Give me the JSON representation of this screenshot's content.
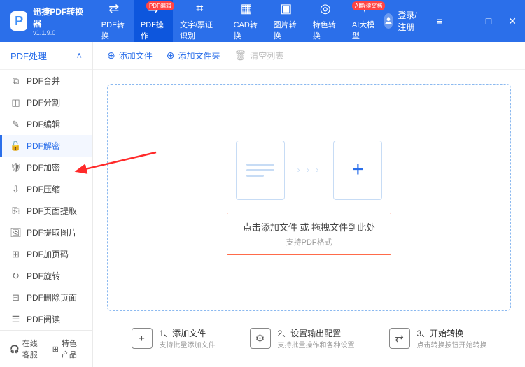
{
  "app": {
    "title": "迅捷PDF转换器",
    "version": "v1.1.9.0"
  },
  "nav": [
    {
      "label": "PDF转换",
      "icon": "⇄"
    },
    {
      "label": "PDF操作",
      "icon": "⇆",
      "badge": "PDF编辑",
      "active": true
    },
    {
      "label": "文字/票证识别",
      "icon": "⌗"
    },
    {
      "label": "CAD转换",
      "icon": "▦"
    },
    {
      "label": "图片转换",
      "icon": "▣"
    },
    {
      "label": "特色转换",
      "icon": "◎"
    },
    {
      "label": "AI大模型",
      "icon": "✦",
      "badge": "AI解读文档"
    }
  ],
  "user": {
    "login_label": "登录/注册"
  },
  "sidebar": {
    "header": "PDF处理",
    "items": [
      {
        "label": "PDF合并",
        "icon": "⧉"
      },
      {
        "label": "PDF分割",
        "icon": "◫"
      },
      {
        "label": "PDF编辑",
        "icon": "✎"
      },
      {
        "label": "PDF解密",
        "icon": "🔓",
        "active": true
      },
      {
        "label": "PDF加密",
        "icon": "🛡"
      },
      {
        "label": "PDF压缩",
        "icon": "⇩"
      },
      {
        "label": "PDF页面提取",
        "icon": "⎘"
      },
      {
        "label": "PDF提取图片",
        "icon": "🖼"
      },
      {
        "label": "PDF加页码",
        "icon": "⊞"
      },
      {
        "label": "PDF旋转",
        "icon": "↻"
      },
      {
        "label": "PDF删除页面",
        "icon": "⊟"
      },
      {
        "label": "PDF阅读",
        "icon": "☰"
      }
    ],
    "footer": {
      "support": "在线客服",
      "featured": "特色产品"
    }
  },
  "toolbar": {
    "add_file": "添加文件",
    "add_folder": "添加文件夹",
    "clear_list": "清空列表"
  },
  "dropzone": {
    "title": "点击添加文件 或 拖拽文件到此处",
    "subtitle": "支持PDF格式"
  },
  "steps": [
    {
      "title": "1、添加文件",
      "sub": "支持批量添加文件",
      "icon": "+"
    },
    {
      "title": "2、设置输出配置",
      "sub": "支持批量操作和各种设置",
      "icon": "⚙"
    },
    {
      "title": "3、开始转换",
      "sub": "点击转换按钮开始转换",
      "icon": "⇄"
    }
  ]
}
